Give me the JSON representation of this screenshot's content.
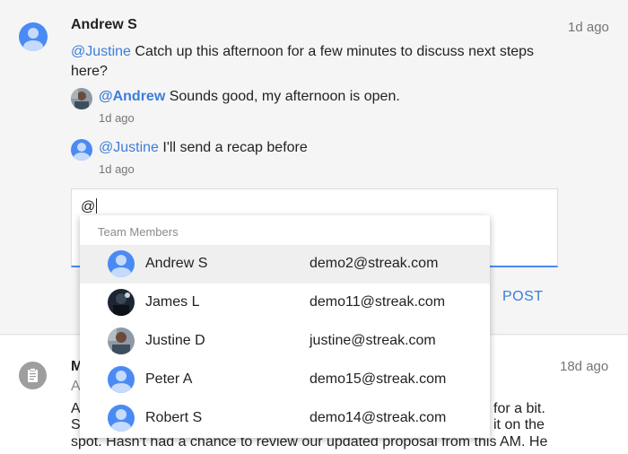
{
  "thread": {
    "author": "Andrew S",
    "time": "1d ago",
    "mention": "@Justine",
    "message_line1": " Catch up this afternoon for a few minutes to discuss next steps",
    "message_line2": "here?"
  },
  "replies": [
    {
      "mention": "@Andrew",
      "text": " Sounds good, my afternoon is open.",
      "time": "1d ago"
    },
    {
      "mention": "@Justine",
      "text": " I'll send a recap before",
      "time": "1d ago"
    }
  ],
  "composer": {
    "value": "@",
    "post_label": "POST"
  },
  "dropdown": {
    "header": "Team Members",
    "members": [
      {
        "name": "Andrew S",
        "email": "demo2@streak.com"
      },
      {
        "name": "James L",
        "email": "demo11@streak.com"
      },
      {
        "name": "Justine D",
        "email": "justine@streak.com"
      },
      {
        "name": "Peter A",
        "email": "demo15@streak.com"
      },
      {
        "name": "Robert S",
        "email": "demo14@streak.com"
      }
    ]
  },
  "next_item": {
    "initial": "M",
    "sub_initial": "A",
    "time": "18d ago",
    "line1_start": "A",
    "line1_end": "for a bit.",
    "line2_start": "S",
    "line2_end": "it on the",
    "line3": "spot. Hasn't had a chance to review our updated proposal from this AM. He"
  },
  "colors": {
    "accent": "#3b7ddd",
    "avatar_blue": "#4a8af4"
  }
}
